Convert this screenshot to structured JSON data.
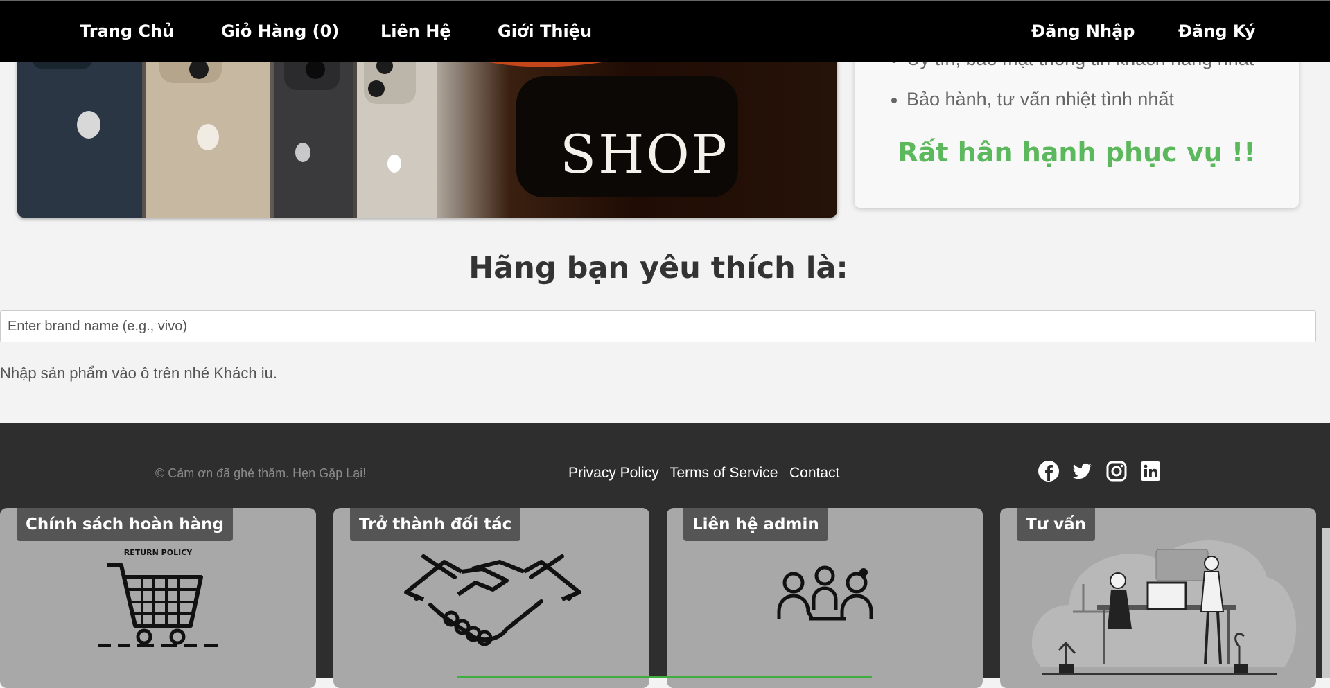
{
  "nav": {
    "home": "Trang Chủ",
    "cart": "Giỏ Hàng (0)",
    "contact": "Liên Hệ",
    "about": "Giới Thiệu",
    "login": "Đăng Nhập",
    "register": "Đăng Ký"
  },
  "hero": {
    "shop_text": "SHOP"
  },
  "info": {
    "bullets": [
      "Uy tín, bảo mật thông tin khách hàng nhất",
      "Bảo hành, tư vấn nhiệt tình nhất"
    ],
    "slogan": "Rất hân hạnh phục vụ !!",
    "slogan_color": "#5cb85c"
  },
  "brand": {
    "heading": "Hãng bạn yêu thích là:",
    "placeholder": "Enter brand name (e.g., vivo)",
    "hint": "Nhập sản phẩm vào ô trên nhé Khách iu."
  },
  "footer": {
    "copyright": "© Cảm ơn đã ghé thăm. Hẹn Gặp Lại!",
    "links": [
      "Privacy Policy",
      "Terms of Service",
      "Contact"
    ],
    "social_icons": [
      "facebook-icon",
      "twitter-icon",
      "instagram-icon",
      "linkedin-icon"
    ],
    "tiles": [
      {
        "label": "Chính sách hoàn hàng",
        "image_text": "RETURN POLICY"
      },
      {
        "label": "Trở thành đối tác"
      },
      {
        "label": "Liên hệ admin"
      },
      {
        "label": "Tư vấn"
      }
    ]
  }
}
